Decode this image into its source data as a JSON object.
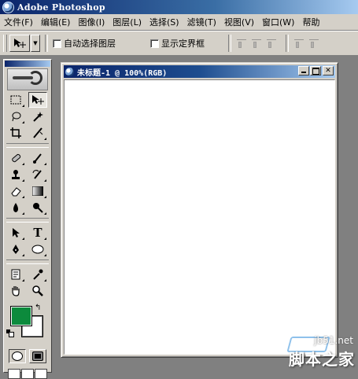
{
  "window": {
    "title": "Adobe Photoshop"
  },
  "menu": [
    "文件(F)",
    "编辑(E)",
    "图像(I)",
    "图层(L)",
    "选择(S)",
    "滤镜(T)",
    "视图(V)",
    "窗口(W)",
    "帮助"
  ],
  "options": {
    "auto_select_label": "自动选择图层",
    "show_bounds_label": "显示定界框"
  },
  "toolbox": {
    "foreground_color": "#0c8a3c",
    "background_color": "#ffffff"
  },
  "document": {
    "title": "未标题-1 @ 100%(RGB)",
    "minimize_glyph": "_",
    "maximize_glyph": "□",
    "close_glyph": "✕"
  },
  "watermark": {
    "url": "jb51.net",
    "text": "脚本之家"
  }
}
